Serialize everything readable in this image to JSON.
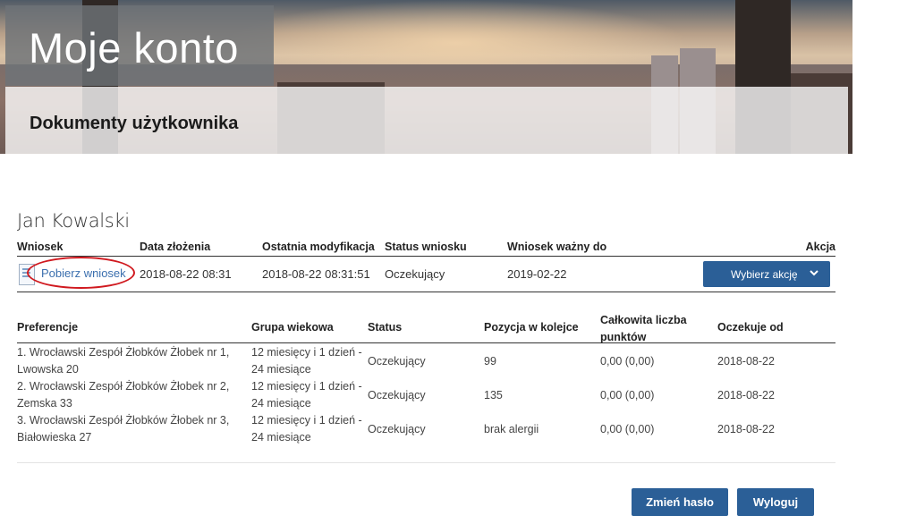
{
  "header": {
    "title": "Moje konto",
    "subtitle": "Dokumenty użytkownika"
  },
  "user": {
    "name": "Jan Kowalski"
  },
  "applications": {
    "columns": [
      "Wniosek",
      "Data złożenia",
      "Ostatnia modyfikacja",
      "Status wniosku",
      "Wniosek ważny do",
      "Akcja"
    ],
    "rows": [
      {
        "download_link": "Pobierz wniosek",
        "submitted": "2018-08-22 08:31",
        "modified": "2018-08-22 08:31:51",
        "status": "Oczekujący",
        "valid_until": "2019-02-22",
        "action_label": "Wybierz akcję"
      }
    ]
  },
  "preferences": {
    "columns": {
      "preference": "Preferencje",
      "age_group": "Grupa wiekowa",
      "status": "Status",
      "queue_position": "Pozycja w kolejce",
      "total_points": "Całkowita liczba punktów",
      "waiting_since": "Oczekuje od"
    },
    "rows": [
      {
        "preference_line1": "1. Wrocławski Zespół Żłobków Żłobek nr 1,",
        "preference_line2": "Lwowska 20",
        "age_group_line1": "12 miesięcy i 1 dzień -",
        "age_group_line2": "24 miesiące",
        "status": "Oczekujący",
        "queue_position": "99",
        "total_points": "0,00 (0,00)",
        "waiting_since": "2018-08-22"
      },
      {
        "preference_line1": "2. Wrocławski Zespół Żłobków Żłobek nr 2,",
        "preference_line2": "Zemska 33",
        "age_group_line1": "12 miesięcy i 1 dzień -",
        "age_group_line2": "24 miesiące",
        "status": "Oczekujący",
        "queue_position": "135",
        "total_points": "0,00 (0,00)",
        "waiting_since": "2018-08-22"
      },
      {
        "preference_line1": "3. Wrocławski Zespół Żłobków Żłobek nr 3,",
        "preference_line2": "Białowieska 27",
        "age_group_line1": "12 miesięcy i 1 dzień -",
        "age_group_line2": "24 miesiące",
        "status": "Oczekujący",
        "queue_position": "brak alergii",
        "total_points": "0,00 (0,00)",
        "waiting_since": "2018-08-22"
      }
    ]
  },
  "footer_buttons": {
    "change_password": "Zmień hasło",
    "logout": "Wyloguj"
  },
  "colors": {
    "primary": "#2b5f97",
    "link": "#3b6fae",
    "highlight": "#d0191f"
  },
  "icons": {
    "document": "document-icon",
    "chevron": "chevron-down-icon"
  }
}
